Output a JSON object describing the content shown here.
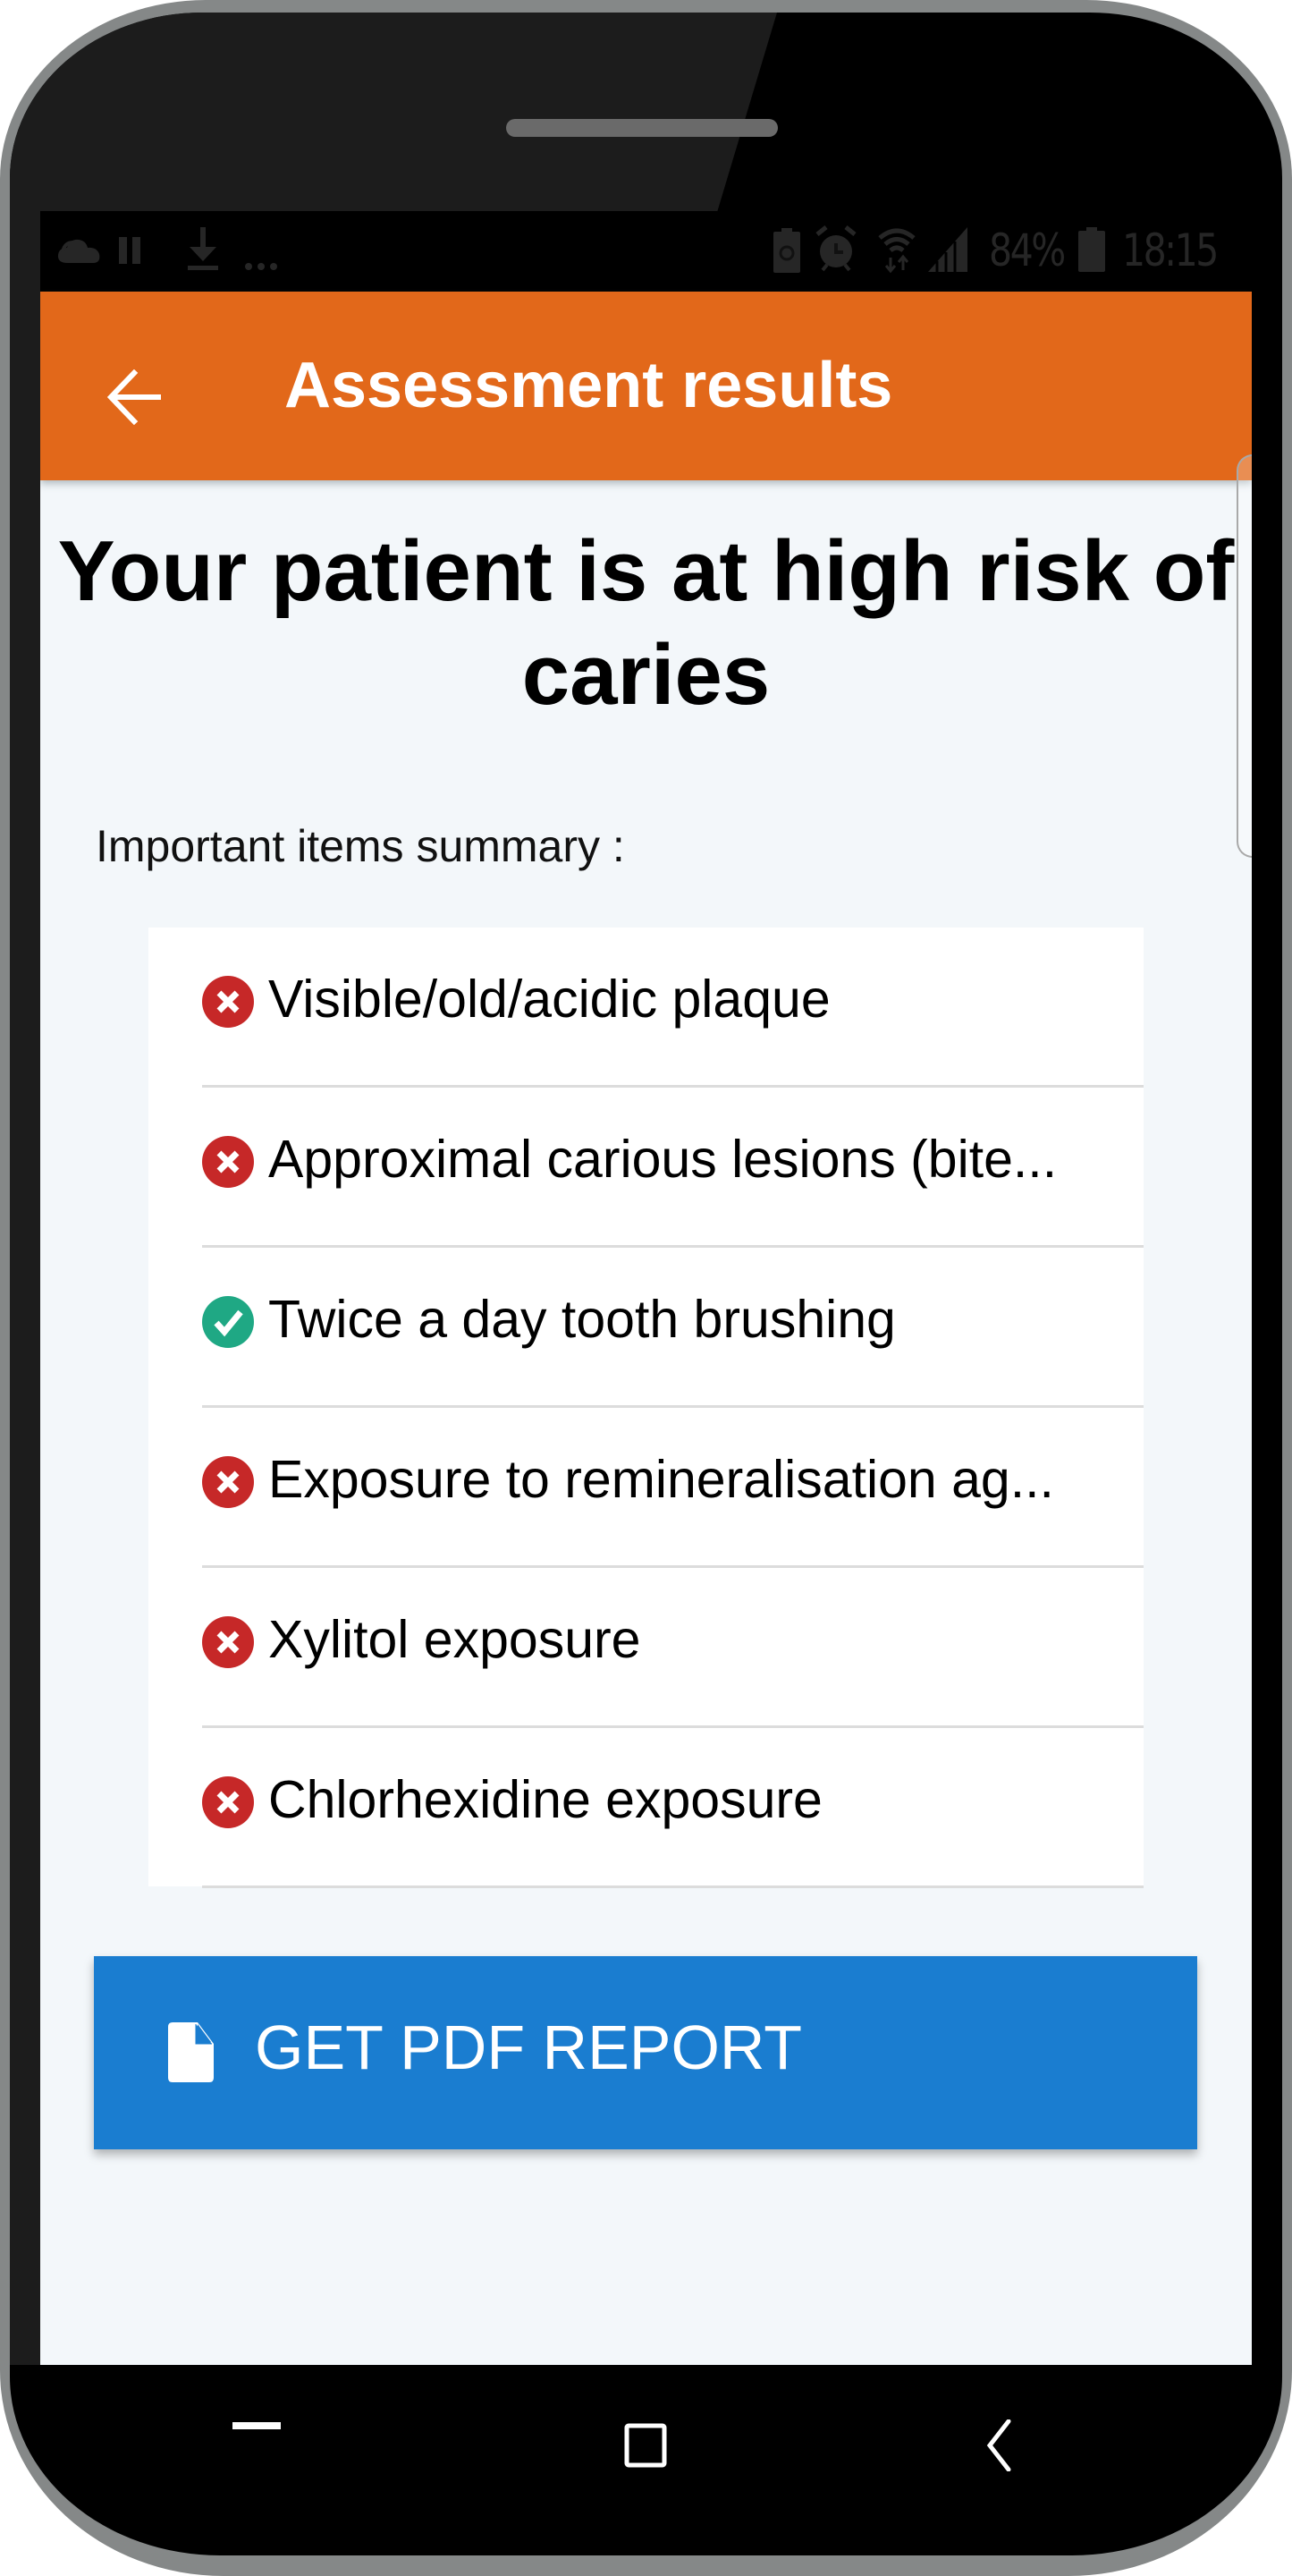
{
  "device": {
    "frame_color": "#858888",
    "bezel_color": "#000000"
  },
  "status_bar": {
    "left_icons": [
      "cloud-sync-icon",
      "pause-icon",
      "download-icon",
      "more-notifications-icon"
    ],
    "right_icons": [
      "battery-saver-icon",
      "alarm-icon",
      "wifi-data-icon",
      "cell-signal-icon"
    ],
    "battery_percent": "84%",
    "battery_icon": "battery-icon",
    "time": "18:15"
  },
  "app_bar": {
    "title": "Assessment results",
    "back_icon": "arrow-left-icon",
    "color": "#e2681a"
  },
  "main": {
    "result_title": "Your patient is at high risk of caries",
    "summary_label": "Important items summary :",
    "items": [
      {
        "label": "Visible/old/acidic plaque",
        "status": "negative",
        "icon": "x-circle-icon"
      },
      {
        "label": "Approximal carious lesions (bite...",
        "status": "negative",
        "icon": "x-circle-icon"
      },
      {
        "label": "Twice a day tooth brushing",
        "status": "positive",
        "icon": "check-circle-icon"
      },
      {
        "label": "Exposure to remineralisation ag...",
        "status": "negative",
        "icon": "x-circle-icon"
      },
      {
        "label": "Xylitol exposure",
        "status": "negative",
        "icon": "x-circle-icon"
      },
      {
        "label": "Chlorhexidine exposure",
        "status": "negative",
        "icon": "x-circle-icon"
      }
    ],
    "status_colors": {
      "negative": "#c62828",
      "positive": "#1fa884"
    },
    "pdf_button": {
      "label": "GET PDF REPORT",
      "icon": "file-icon",
      "color": "#1a7dd0"
    }
  },
  "nav_bar": {
    "buttons": [
      "recents-button",
      "home-button",
      "back-button"
    ]
  }
}
